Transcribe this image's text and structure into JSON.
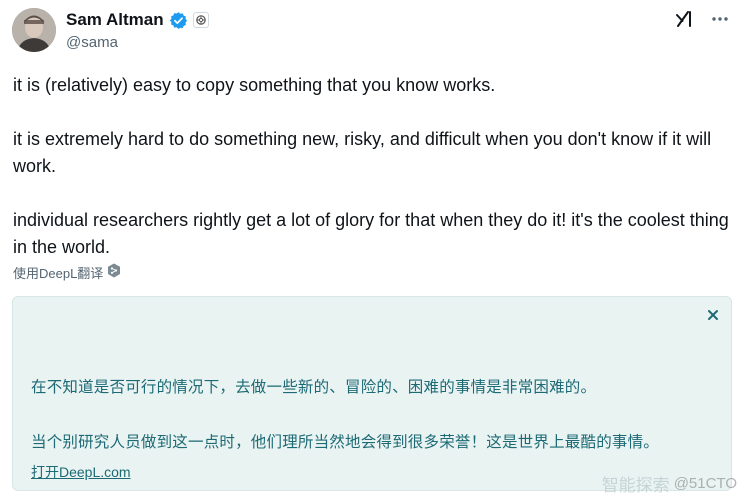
{
  "author": {
    "display_name": "Sam Altman",
    "handle": "@sama"
  },
  "tweet": {
    "paragraph_1": "it is (relatively) easy to copy something that you know works.",
    "paragraph_2": "it is extremely hard to do something new, risky, and difficult when you don't know if it will work.",
    "paragraph_3": "individual researchers rightly get a lot of glory for that when they do it! it's the coolest thing in the world."
  },
  "translate": {
    "link_label": "使用DeepL翻译"
  },
  "translation": {
    "line_1": "在不知道是否可行的情况下，去做一些新的、冒险的、困难的事情是非常困难的。",
    "line_2": "当个别研究人员做到这一点时，他们理所当然地会得到很多荣誉！这是世界上最酷的事情。",
    "open_link": "打开DeepL.com",
    "close_symbol": "✕"
  },
  "watermark": {
    "faded_text": "智能探索",
    "brand": "@51CTO"
  },
  "icons": {
    "verified": "verified-badge-icon",
    "affiliation": "openai-affiliation-icon",
    "grok": "grok-icon",
    "more": "more-icon",
    "deepl": "deepl-icon"
  },
  "colors": {
    "verified_blue": "#1d9bf0",
    "translation_bg": "#e8f3f2",
    "translation_text": "#1d6a75"
  }
}
